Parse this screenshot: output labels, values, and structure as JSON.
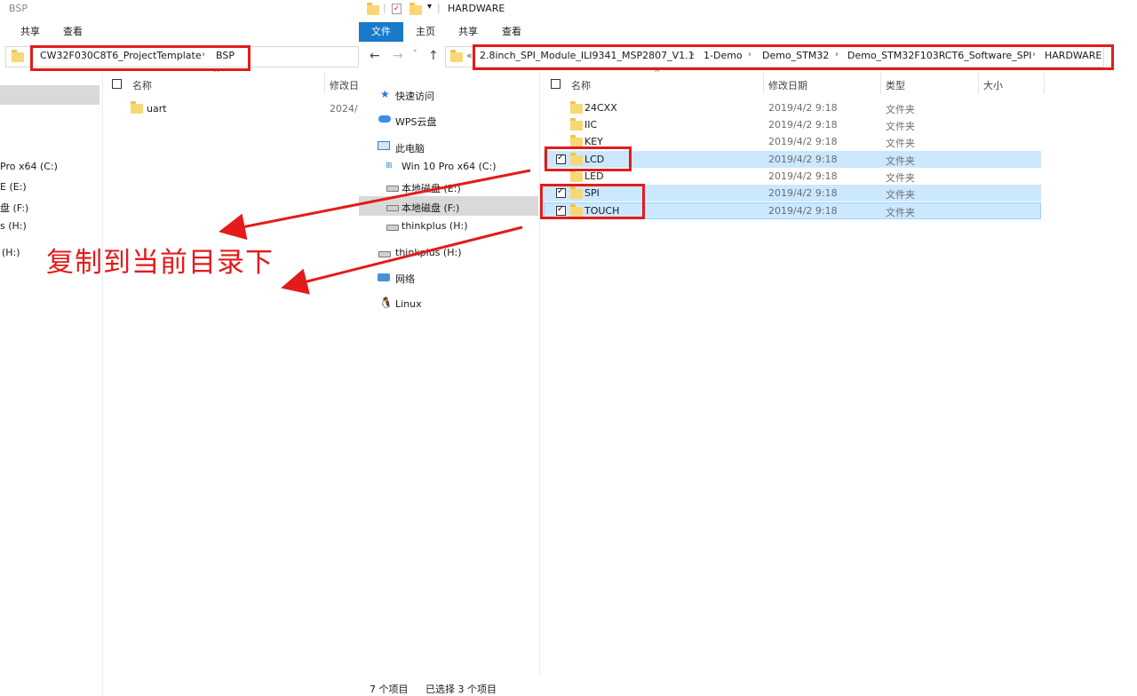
{
  "left_window": {
    "title": "BSP",
    "tabs": [
      "共享",
      "查看"
    ],
    "breadcrumb": [
      "CW32F030C8T6_ProjectTemplate",
      "BSP"
    ],
    "columns": [
      "名称",
      "修改日"
    ],
    "files": [
      {
        "name": "uart",
        "date": "2024/"
      }
    ],
    "nav": [
      "Pro x64 (C:)",
      "E (E:)",
      "盘 (F:)",
      "s (H:)",
      "(H:)"
    ]
  },
  "right_window": {
    "title": "HARDWARE",
    "tabs": [
      "文件",
      "主页",
      "共享",
      "查看"
    ],
    "breadcrumb_overflow": "«",
    "breadcrumb": [
      "2.8inch_SPI_Module_ILI9341_MSP2807_V1.1",
      "1-Demo",
      "Demo_STM32",
      "Demo_STM32F103RCT6_Software_SPI",
      "HARDWARE"
    ],
    "columns": [
      "名称",
      "修改日期",
      "类型",
      "大小"
    ],
    "files": [
      {
        "name": "24CXX",
        "date": "2019/4/2 9:18",
        "type": "文件夹",
        "selected": false
      },
      {
        "name": "IIC",
        "date": "2019/4/2 9:18",
        "type": "文件夹",
        "selected": false
      },
      {
        "name": "KEY",
        "date": "2019/4/2 9:18",
        "type": "文件夹",
        "selected": false
      },
      {
        "name": "LCD",
        "date": "2019/4/2 9:18",
        "type": "文件夹",
        "selected": true
      },
      {
        "name": "LED",
        "date": "2019/4/2 9:18",
        "type": "文件夹",
        "selected": false
      },
      {
        "name": "SPI",
        "date": "2019/4/2 9:18",
        "type": "文件夹",
        "selected": true
      },
      {
        "name": "TOUCH",
        "date": "2019/4/2 9:18",
        "type": "文件夹",
        "selected": true
      }
    ],
    "nav": [
      {
        "label": "快速访问",
        "icon": "star-icon"
      },
      {
        "label": "WPS云盘",
        "icon": "cloud-icon"
      },
      {
        "label": "此电脑",
        "icon": "computer-icon"
      },
      {
        "label": "Win 10 Pro x64 (C:)",
        "icon": "windows-drive-icon"
      },
      {
        "label": "本地磁盘 (E:)",
        "icon": "drive-icon"
      },
      {
        "label": "本地磁盘 (F:)",
        "icon": "drive-icon"
      },
      {
        "label": "thinkplus (H:)",
        "icon": "drive-icon"
      },
      {
        "label": "thinkplus (H:)",
        "icon": "drive-icon"
      },
      {
        "label": "网络",
        "icon": "network-icon"
      },
      {
        "label": "Linux",
        "icon": "linux-icon"
      }
    ],
    "status": {
      "count": "7 个项目",
      "selected": "已选择 3 个项目"
    }
  },
  "annotation": {
    "text": "复制到当前目录下",
    "color": "#e31b1b"
  },
  "colors": {
    "accent": "#1979ca",
    "selection": "#cce8ff",
    "annotation": "#e31b1b",
    "folder": "#f8d775"
  }
}
